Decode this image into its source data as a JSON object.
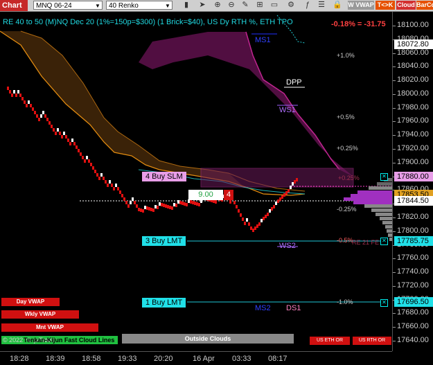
{
  "toolbar": {
    "chart_tab": "Chart",
    "instrument": "MNQ 06-24",
    "bar_type": "40 Renko",
    "vwap_button": "W VWAP",
    "tk_button": "T<>K",
    "cloud_button": "Cloud",
    "barco_button": "BarCo"
  },
  "chart_data": {
    "type": "renko",
    "title": "RE 40 to 50 (M)NQ Dec 20 (1%=150p=$300) (1 Brick=$40), US Dy RTH %, ETH TPO",
    "change": "-0.18% = -31.75",
    "y_ticks": [
      "18100.00",
      "18080.00",
      "18060.00",
      "18040.00",
      "18020.00",
      "18000.00",
      "17980.00",
      "17960.00",
      "17940.00",
      "17920.00",
      "17900.00",
      "17880.00",
      "17860.00",
      "17840.00",
      "17820.00",
      "17800.00",
      "17780.00",
      "17760.00",
      "17740.00",
      "17720.00",
      "17700.00",
      "17680.00",
      "17660.00",
      "17640.00"
    ],
    "y_range": [
      17640,
      18100
    ],
    "x_ticks": [
      "18:28",
      "18:39",
      "18:58",
      "19:33",
      "20:20",
      "16 Apr",
      "03:33",
      "08:17"
    ],
    "price_tags": {
      "ms1": "18072.80",
      "buy_slm": "17880.00",
      "last_alt": "17853.50",
      "last": "17844.50",
      "buy_lmt3": "17785.75",
      "buy_lmt1": "17696.50"
    },
    "levels": {
      "ms1": "MS1",
      "dpp": "DPP",
      "ws1": "WS1",
      "ws2": "WS2",
      "ms2": "MS2",
      "ds1": "DS1"
    },
    "percent_labels": [
      "+1.0%",
      "+0.5%",
      "+0.25%",
      "-0.25%",
      "-0.5%",
      "-1.0%"
    ],
    "faint_labels": {
      "upper": "+0.25%",
      "lower": "RE 21 FE"
    },
    "orders": {
      "buy_slm": "4 Buy SLM",
      "buy_lmt3": "3 Buy LMT",
      "buy_lmt1": "1 Buy LMT",
      "entry_price": "9.00",
      "entry_qty": "4"
    },
    "vwap_labels": [
      "Day VWAP",
      "Wkly VWAP",
      "Mnt VWAP"
    ],
    "footer": {
      "copyright": "© 2022 NinjaTrader",
      "ichimoku": "Tenkan-Kijun Fast Cloud Lines",
      "outside_clouds": "Outside Clouds",
      "us_eth_or": "US ETH OR",
      "us_rth_or": "US RTH OR"
    },
    "colors": {
      "bull": "#ffffff",
      "bear": "#e01010",
      "accent": "#00e5ee",
      "cloud_magenta": "#b0208a",
      "cloud_orange": "#e08a10"
    }
  }
}
